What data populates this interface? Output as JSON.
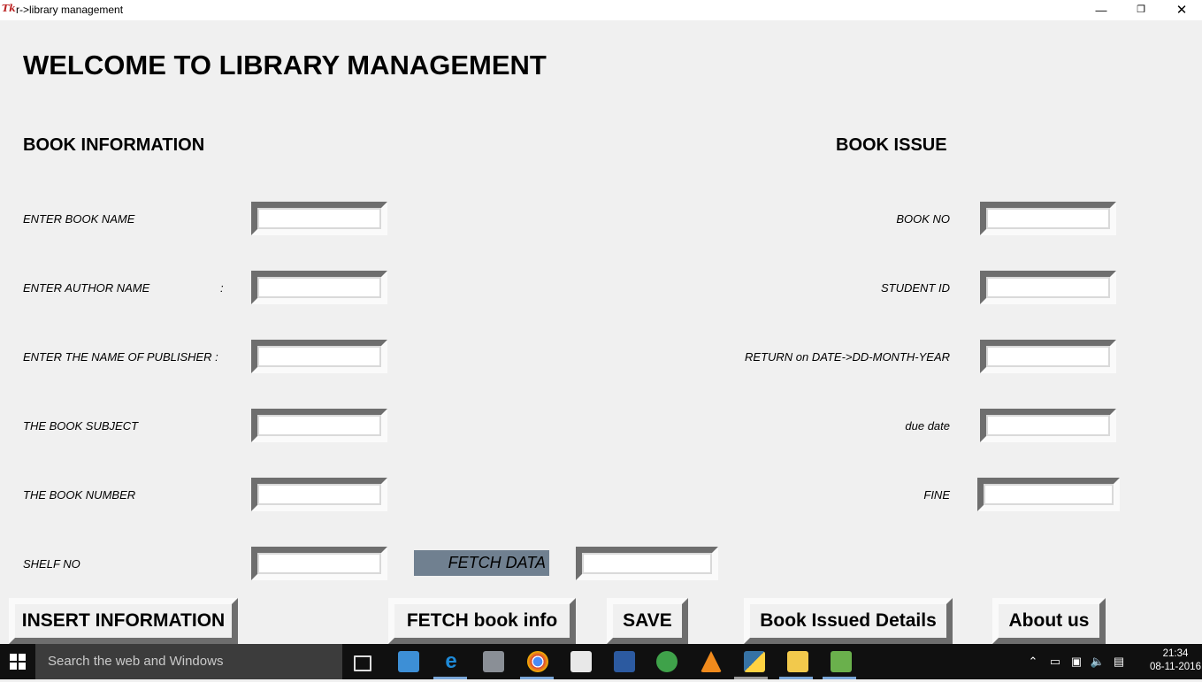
{
  "window": {
    "title": "r->library management",
    "app_icon": "Tk",
    "minimize_icon": "—",
    "maximize_icon": "❐",
    "close_icon": "✕"
  },
  "main": {
    "title": "WELCOME TO LIBRARY MANAGEMENT",
    "book_info": {
      "heading": "BOOK INFORMATION",
      "fields": [
        {
          "label": "ENTER BOOK NAME",
          "value": ""
        },
        {
          "label": "ENTER AUTHOR NAME",
          "colon": ":",
          "value": ""
        },
        {
          "label": "ENTER THE NAME OF PUBLISHER :",
          "value": ""
        },
        {
          "label": "THE BOOK SUBJECT",
          "value": ""
        },
        {
          "label": "THE BOOK NUMBER",
          "value": ""
        },
        {
          "label": "SHELF NO",
          "value": ""
        }
      ]
    },
    "fetch_data_label": "FETCH DATA",
    "fetch_data_value": "",
    "book_issue": {
      "heading": "BOOK ISSUE",
      "fields": [
        {
          "label": "BOOK NO",
          "value": ""
        },
        {
          "label": "STUDENT ID",
          "value": ""
        },
        {
          "label": "RETURN on DATE->DD-MONTH-YEAR",
          "value": ""
        },
        {
          "label": "due date",
          "value": ""
        },
        {
          "label": "FINE",
          "value": ""
        }
      ]
    },
    "buttons": {
      "insert": "INSERT INFORMATION",
      "fetch": "FETCH book info",
      "save": "SAVE",
      "issued": "Book Issued Details",
      "about": "About us"
    }
  },
  "taskbar": {
    "start_icon": "windows-logo",
    "search_placeholder": "Search the web and Windows",
    "time": "21:34",
    "date": "08-11-2016",
    "colors": {
      "background": "#101010",
      "search": "#3c3c3c",
      "running_indicator": "#7aa6d8"
    }
  }
}
